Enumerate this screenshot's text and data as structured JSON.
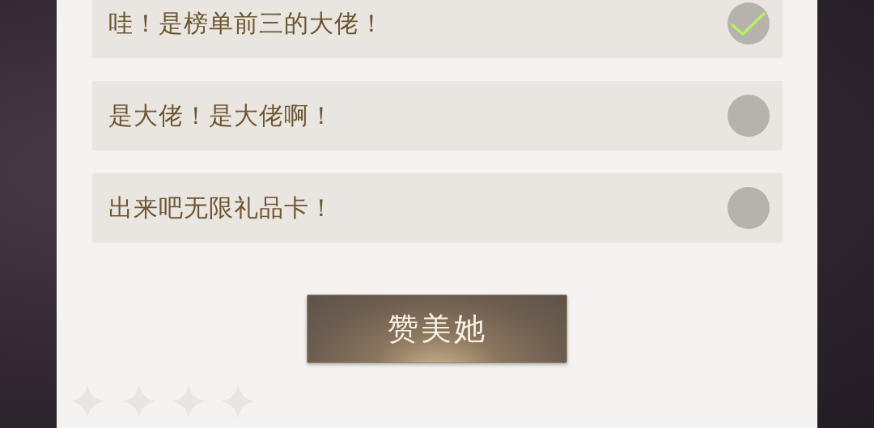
{
  "options": [
    {
      "text": "哇！是榜单前三的大佬！",
      "selected": true
    },
    {
      "text": "是大佬！是大佬啊！",
      "selected": false
    },
    {
      "text": "出来吧无限礼品卡！",
      "selected": false
    }
  ],
  "button": {
    "label": "赞美她"
  }
}
